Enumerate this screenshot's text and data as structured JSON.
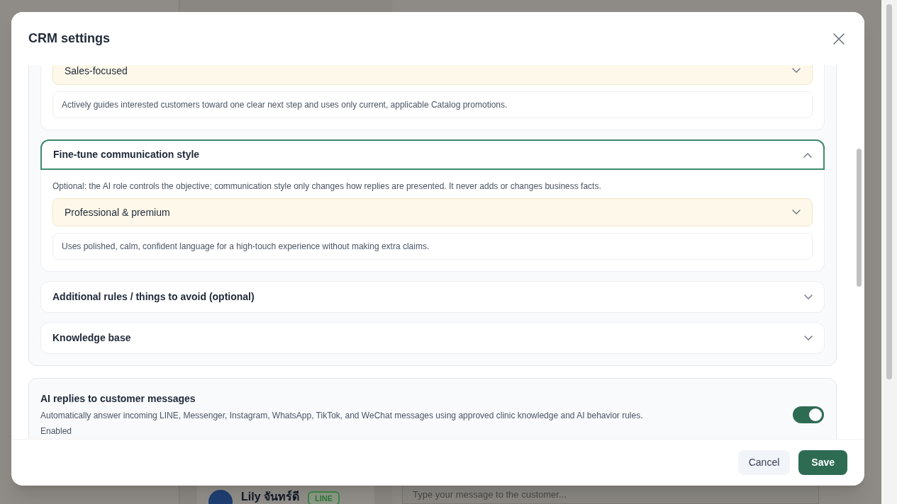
{
  "dialog": {
    "title": "CRM settings",
    "sections": [
      {
        "kind": "select_card",
        "value": "Sales-focused",
        "description": "Actively guides interested customers toward one clear next step and uses only current, applicable Catalog promotions."
      },
      {
        "kind": "accordion",
        "title": "Fine-tune communication style",
        "expanded": true,
        "note": "Optional: the AI role controls the objective; communication style only changes how replies are presented. It never adds or changes business facts.",
        "value": "Professional & premium",
        "description": "Uses polished, calm, confident language for a high-touch experience without making extra claims."
      },
      {
        "kind": "accordion",
        "title": "Additional rules / things to avoid (optional)",
        "expanded": false
      },
      {
        "kind": "accordion",
        "title": "Knowledge base",
        "expanded": false
      }
    ],
    "ai_replies": {
      "title": "AI replies to customer messages",
      "description": "Automatically answer incoming LINE, Messenger, Instagram, WhatsApp, TikTok, and WeChat messages using approved clinic knowledge and AI behavior rules.",
      "status": "Enabled",
      "on": true
    },
    "buttons": [
      {
        "label": "Cancel",
        "kind": "secondary"
      },
      {
        "label": "Save",
        "kind": "primary"
      }
    ]
  },
  "background": {
    "contact_name": "Lily จันทร์ดี",
    "channel_badge": "LINE",
    "message_placeholder": "Type your message to the customer..."
  }
}
